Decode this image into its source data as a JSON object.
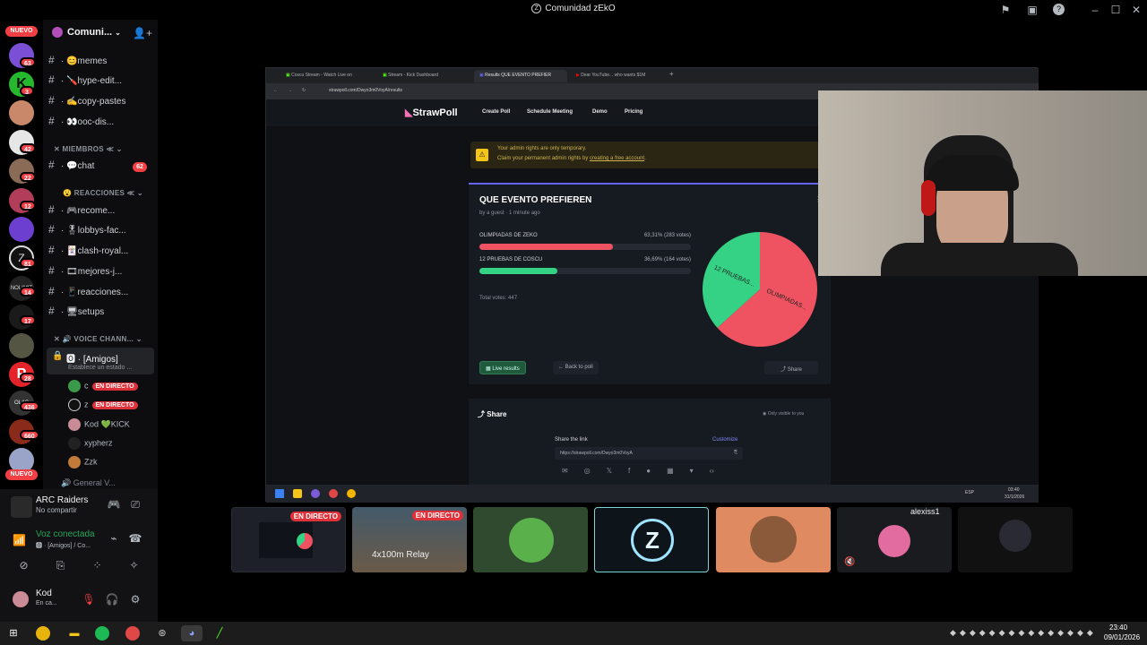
{
  "window": {
    "title": "Comunidad zEkO"
  },
  "rail": {
    "nuevo_top": "NUEVO",
    "nuevo_bottom": "NUEVO",
    "badges": [
      "63",
      "3",
      "42",
      "22",
      "12",
      "81",
      "14",
      "17",
      "28",
      "436",
      "660"
    ]
  },
  "sidebar": {
    "server_name": "Comuni...",
    "channels": [
      {
        "label": "· 😊memes"
      },
      {
        "label": "· 🪛hype-edit..."
      },
      {
        "label": "· ✍️copy-pastes"
      },
      {
        "label": "· 👀ooc-dis..."
      }
    ],
    "cat_members": "MIEMBROS ≪",
    "chat": {
      "label": "· 💬chat",
      "count": "62"
    },
    "cat_reactions": "😮 REACCIONES ≪",
    "channels2": [
      {
        "label": "· 🎮recome..."
      },
      {
        "label": "· 🎖lobbys-fac..."
      },
      {
        "label": "· 🃏clash-royal..."
      },
      {
        "label": "· 🎞mejores-j..."
      },
      {
        "label": "· 📱reacciones..."
      },
      {
        "label": "· 🖥setups"
      }
    ],
    "cat_voice": "🔊 VOICE CHANN...",
    "voice_channel": "🅾 · [Amigos]",
    "voice_status": "Establece un estado ...",
    "voice_users": [
      {
        "name": "c",
        "live": "EN DIRECTO"
      },
      {
        "name": "z",
        "live": "EN DIRECTO"
      },
      {
        "name": "Kod 💚KICK",
        "live": ""
      },
      {
        "name": "xypherz",
        "live": ""
      },
      {
        "name": "Zzk",
        "live": ""
      }
    ],
    "general": "General V..."
  },
  "userpanel": {
    "activity_title": "ARC Raiders",
    "activity_sub": "No compartir",
    "voice_connected": "Voz conectada",
    "voice_sub": "🅾 · [Amigos] / Co...",
    "username": "Kod",
    "user_status": "En ca..."
  },
  "browser": {
    "tabs": [
      "Coscu Stream - Watch Live on",
      "Stream - Kick Dashboard",
      "Results QUE EVENTO PREFIER",
      "Dear YouTube... who wants $1M"
    ],
    "url": "strawpoll.com/Dwyo3m0VoyA/results",
    "brand": "StrawPoll",
    "nav": [
      "Create Poll",
      "Schedule Meeting",
      "Demo",
      "Pricing"
    ],
    "notice_line1": "Your admin rights are only temporary.",
    "notice_line2_a": "Claim your permanent admin rights by ",
    "notice_line2_link": "creating a free account",
    "notice_line2_end": ".",
    "poll_title": "QUE EVENTO PREFIEREN",
    "poll_meta": "by a guest · 1 minute ago",
    "options": [
      {
        "label": "OLIMPIADAS DE ZEKO",
        "result": "63,31% (283 votes)",
        "pct": 63.31,
        "color": "#ef5361"
      },
      {
        "label": "12 PRUEBAS DE COSCU",
        "result": "36,69% (164 votes)",
        "pct": 36.69,
        "color": "#35d185"
      }
    ],
    "total": "Total votes: 447",
    "pie_labels": [
      "OLIMPIADAS...",
      "12 PRUEBAS..."
    ],
    "btn_live": "Live results",
    "btn_back": "← Back to poll",
    "btn_share": "Share",
    "share_title": "Share",
    "share_visibility": "Only visible to you",
    "share_link_label": "Share the link",
    "share_customize": "Customize",
    "share_link": "https://strawpoll.com/Dwyo3m0VoyA",
    "tray_lang": "ESP",
    "tray_time": "03:40",
    "tray_date": "31/1/2026"
  },
  "thumbs": {
    "live1": "EN DIRECTO",
    "live2": "EN DIRECTO",
    "relay": "4x100m Relay",
    "user": "alexiss1"
  },
  "clock": {
    "time": "23:40",
    "date": "09/01/2026"
  }
}
